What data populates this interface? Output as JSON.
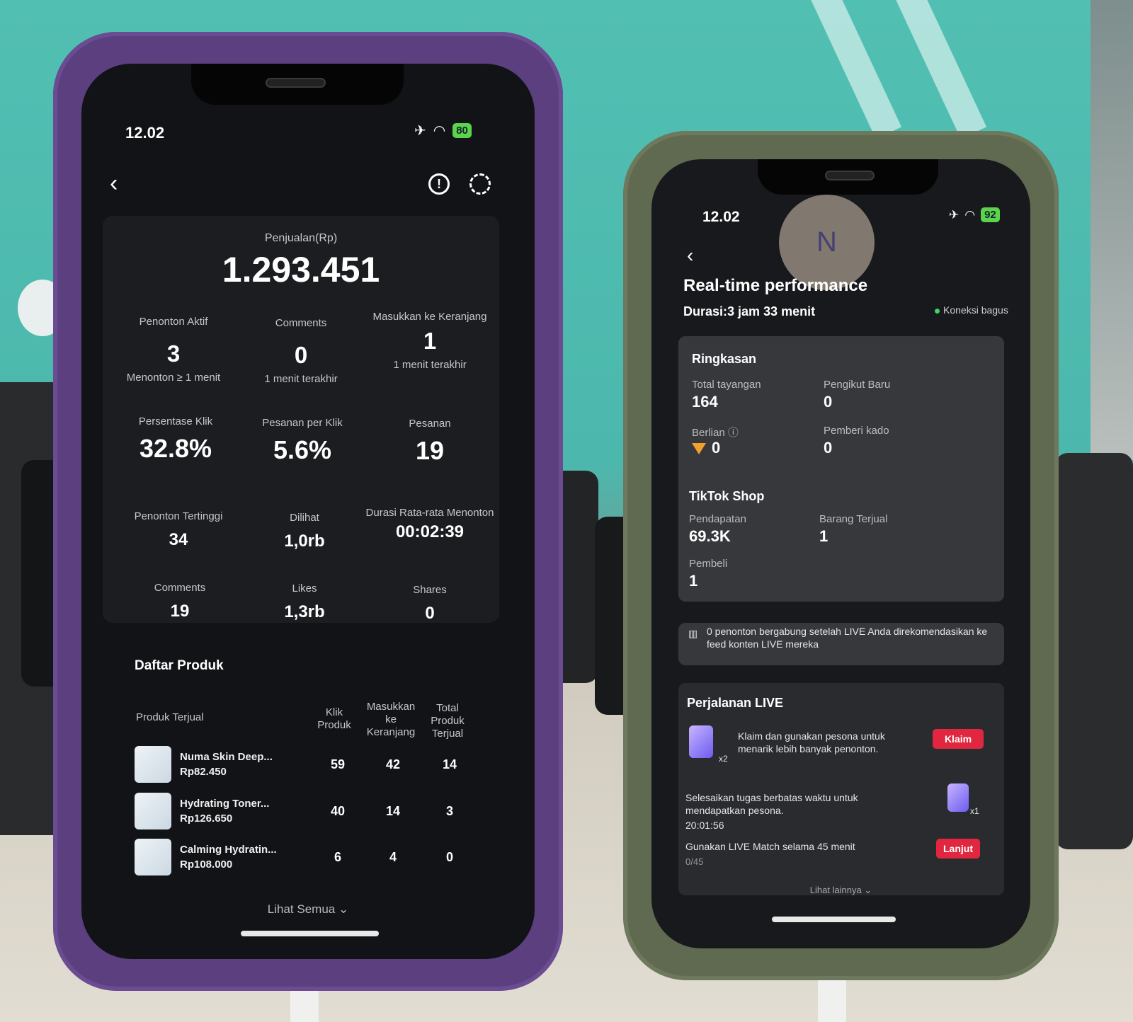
{
  "left_phone": {
    "status": {
      "time": "12.02",
      "battery": "80"
    },
    "sales": {
      "label": "Penjualan(Rp)",
      "value": "1.293.451"
    },
    "metrics_row1": [
      {
        "label": "Penonton Aktif",
        "value": "3",
        "sub": "Menonton ≥ 1 menit"
      },
      {
        "label": "Comments",
        "value": "0",
        "sub": "1 menit terakhir"
      },
      {
        "label": "Masukkan ke Keranjang",
        "value": "1",
        "sub": "1 menit terakhir"
      }
    ],
    "metrics_row2": [
      {
        "label": "Persentase Klik",
        "value": "32.8%"
      },
      {
        "label": "Pesanan per Klik",
        "value": "5.6%"
      },
      {
        "label": "Pesanan",
        "value": "19"
      }
    ],
    "metrics_row3": [
      {
        "label": "Penonton Tertinggi",
        "value": "34"
      },
      {
        "label": "Dilihat",
        "value": "1,0rb"
      },
      {
        "label": "Durasi Rata-rata Menonton",
        "value": "00:02:39"
      }
    ],
    "metrics_row4": [
      {
        "label": "Comments",
        "value": "19"
      },
      {
        "label": "Likes",
        "value": "1,3rb"
      },
      {
        "label": "Shares",
        "value": "0"
      }
    ],
    "products": {
      "title": "Daftar Produk",
      "col_product": "Produk Terjual",
      "col_clicks": "Klik Produk",
      "col_cart": "Masukkan ke Keranjang",
      "col_sold": "Total Produk Terjual",
      "rows": [
        {
          "name": "Numa Skin Deep...",
          "price": "Rp82.450",
          "clicks": "59",
          "cart": "42",
          "sold": "14"
        },
        {
          "name": "Hydrating Toner...",
          "price": "Rp126.650",
          "clicks": "40",
          "cart": "14",
          "sold": "3"
        },
        {
          "name": "Calming Hydratin...",
          "price": "Rp108.000",
          "clicks": "6",
          "cart": "4",
          "sold": "0"
        }
      ],
      "see_all": "Lihat Semua ⌄"
    }
  },
  "right_phone": {
    "status": {
      "time": "12.02",
      "battery": "92"
    },
    "title": "Real-time performance",
    "duration": "Durasi:3 jam 33 menit",
    "connection": "Koneksi bagus",
    "summary": {
      "title": "Ringkasan",
      "total_views_label": "Total tayangan",
      "total_views": "164",
      "new_followers_label": "Pengikut Baru",
      "new_followers": "0",
      "diamonds_label": "Berlian",
      "diamonds": "0",
      "gifters_label": "Pemberi kado",
      "gifters": "0"
    },
    "shop": {
      "title": "TikTok Shop",
      "revenue_label": "Pendapatan",
      "revenue": "69.3K",
      "items_sold_label": "Barang Terjual",
      "items_sold": "1",
      "buyers_label": "Pembeli",
      "buyers": "1"
    },
    "live_feed_note": "0 penonton bergabung setelah LIVE Anda direkomendasikan ke feed konten LIVE mereka",
    "journey": {
      "title": "Perjalanan LIVE",
      "task1": "Klaim dan gunakan pesona untuk menarik lebih banyak penonton.",
      "task1_count": "x2",
      "task1_button": "Klaim",
      "task2": "Selesaikan tugas berbatas waktu untuk mendapatkan pesona.",
      "task2_timer": "20:01:56",
      "task2_count": "x1",
      "task3": "Gunakan LIVE Match selama 45 menit",
      "task3_progress": "0/45",
      "task3_button": "Lanjut"
    },
    "see_more": "Lihat lainnya ⌄"
  }
}
